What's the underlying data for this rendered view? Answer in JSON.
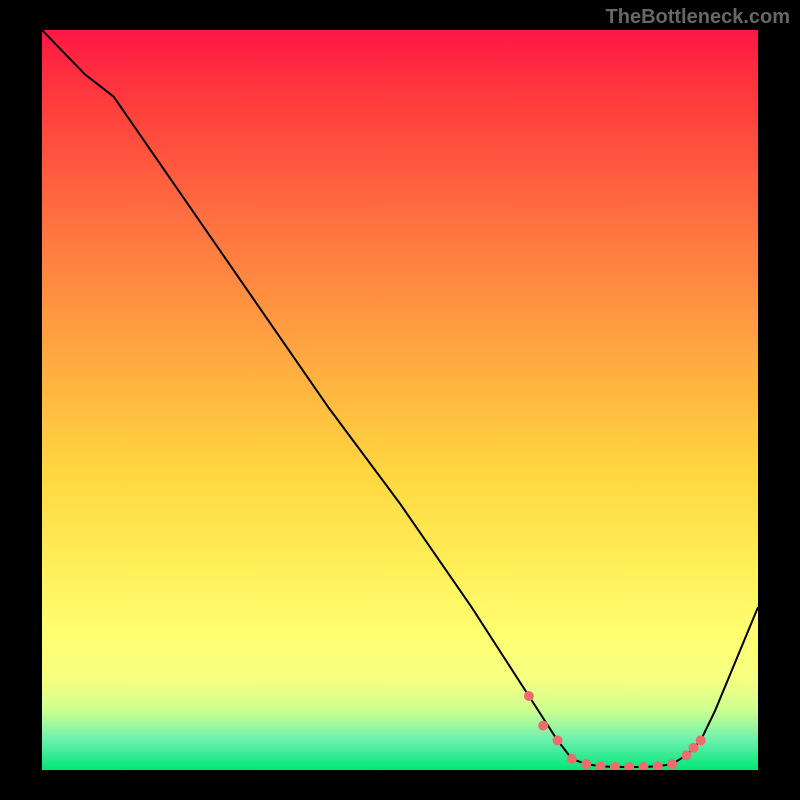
{
  "watermark": "TheBottleneck.com",
  "colors": {
    "curve": "#000000",
    "dots": "#ef6c6c"
  },
  "chart_data": {
    "type": "line",
    "title": "",
    "xlabel": "",
    "ylabel": "",
    "xlim": [
      0,
      100
    ],
    "ylim": [
      0,
      100
    ],
    "x": [
      0,
      6,
      10,
      20,
      30,
      40,
      50,
      60,
      68,
      72,
      74,
      76,
      78,
      80,
      82,
      84,
      86,
      88,
      90,
      92,
      94,
      100
    ],
    "values": [
      100,
      94,
      91,
      77,
      63,
      49,
      36,
      22,
      10,
      4,
      1.5,
      0.8,
      0.5,
      0.4,
      0.4,
      0.4,
      0.5,
      0.8,
      2,
      4,
      8,
      22
    ],
    "dot_x": [
      68,
      70,
      72,
      74,
      76,
      78,
      80,
      82,
      84,
      86,
      88,
      90,
      91,
      92
    ],
    "dot_y": [
      10,
      6,
      4,
      1.5,
      0.8,
      0.5,
      0.4,
      0.4,
      0.4,
      0.5,
      0.8,
      2,
      3,
      4
    ]
  }
}
